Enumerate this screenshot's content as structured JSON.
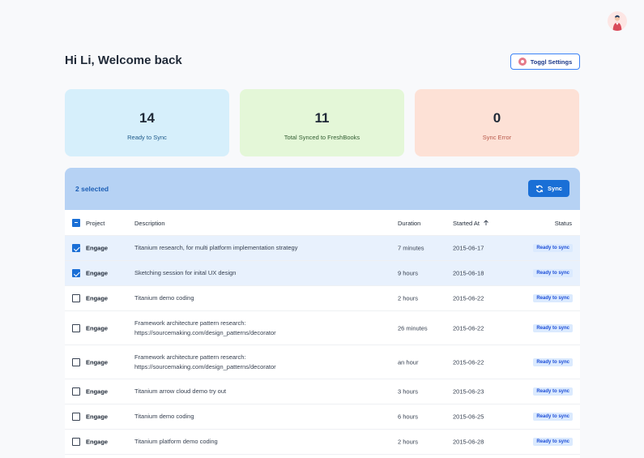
{
  "header": {
    "greeting": "Hi Li, Welcome back",
    "settings_label": "Toggl Settings"
  },
  "stats": [
    {
      "value": "14",
      "label": "Ready to Sync"
    },
    {
      "value": "11",
      "label": "Total Synced to FreshBooks"
    },
    {
      "value": "0",
      "label": "Sync Error"
    }
  ],
  "selection": {
    "count_label": "2 selected",
    "sync_label": "Sync"
  },
  "table": {
    "columns": {
      "project": "Project",
      "description": "Description",
      "duration": "Duration",
      "started_at": "Started At",
      "status": "Status"
    },
    "sort": {
      "column": "started_at",
      "direction": "ascending"
    },
    "rows": [
      {
        "selected": true,
        "project": "Engage",
        "description": "Titanium research, for multi platform implementation strategy",
        "description2": "",
        "duration": "7 minutes",
        "started_at": "2015-06-17",
        "status": "Ready to sync"
      },
      {
        "selected": true,
        "project": "Engage",
        "description": "Sketching session for inital UX design",
        "description2": "",
        "duration": "9 hours",
        "started_at": "2015-06-18",
        "status": "Ready to sync"
      },
      {
        "selected": false,
        "project": "Engage",
        "description": "Titanium demo coding",
        "description2": "",
        "duration": "2 hours",
        "started_at": "2015-06-22",
        "status": "Ready to sync"
      },
      {
        "selected": false,
        "project": "Engage",
        "description": "Framework architecture pattern research:",
        "description2": "https://sourcemaking.com/design_patterns/decorator",
        "duration": "26 minutes",
        "started_at": "2015-06-22",
        "status": "Ready to sync"
      },
      {
        "selected": false,
        "project": "Engage",
        "description": "Framework architecture pattern research:",
        "description2": "https://sourcemaking.com/design_patterns/decorator",
        "duration": "an hour",
        "started_at": "2015-06-22",
        "status": "Ready to sync"
      },
      {
        "selected": false,
        "project": "Engage",
        "description": "Titanium arrow cloud demo try out",
        "description2": "",
        "duration": "3 hours",
        "started_at": "2015-06-23",
        "status": "Ready to sync"
      },
      {
        "selected": false,
        "project": "Engage",
        "description": "Titanium demo coding",
        "description2": "",
        "duration": "6 hours",
        "started_at": "2015-06-25",
        "status": "Ready to sync"
      },
      {
        "selected": false,
        "project": "Engage",
        "description": "Titanium platform demo coding",
        "description2": "",
        "duration": "2 hours",
        "started_at": "2015-06-28",
        "status": "Ready to sync"
      }
    ]
  },
  "colors": {
    "accent": "#1a6fd6",
    "ready_card": "#d6effb",
    "synced_card": "#e4f7d8",
    "error_card": "#fde1d6",
    "selection_bar": "#b6d2f4"
  }
}
